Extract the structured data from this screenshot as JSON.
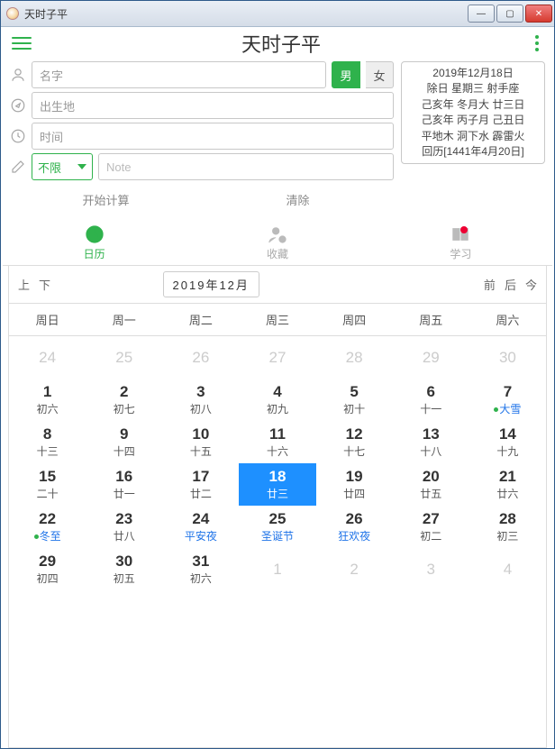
{
  "window": {
    "title": "天时子平"
  },
  "appbar": {
    "title": "天时子平"
  },
  "form": {
    "name_placeholder": "名字",
    "birthplace_placeholder": "出生地",
    "time_placeholder": "时间",
    "gender_male": "男",
    "gender_female": "女",
    "limit_label": "不限",
    "note_placeholder": "Note"
  },
  "info": {
    "l1": "2019年12月18日",
    "l2": "除日 星期三 射手座",
    "l3": "己亥年 冬月大 廿三日",
    "l4": "己亥年 丙子月 己丑日",
    "l5": "平地木 洞下水 霹雷火",
    "l6": "回历[1441年4月20日]"
  },
  "actions": {
    "start": "开始计算",
    "clear": "清除"
  },
  "tabs": {
    "calendar": "日历",
    "favorites": "收藏",
    "study": "学习"
  },
  "calnav": {
    "prev_page": "上",
    "next_page": "下",
    "month_label": "2019年12月",
    "prev": "前",
    "next": "后",
    "today": "今"
  },
  "weekdays": [
    "周日",
    "周一",
    "周二",
    "周三",
    "周四",
    "周五",
    "周六"
  ],
  "cells": [
    {
      "d": "24",
      "s": "",
      "cls": "dim"
    },
    {
      "d": "25",
      "s": "",
      "cls": "dim"
    },
    {
      "d": "26",
      "s": "",
      "cls": "dim"
    },
    {
      "d": "27",
      "s": "",
      "cls": "dim"
    },
    {
      "d": "28",
      "s": "",
      "cls": "dim"
    },
    {
      "d": "29",
      "s": "",
      "cls": "dim"
    },
    {
      "d": "30",
      "s": "",
      "cls": "dim"
    },
    {
      "d": "1",
      "s": "初六"
    },
    {
      "d": "2",
      "s": "初七"
    },
    {
      "d": "3",
      "s": "初八"
    },
    {
      "d": "4",
      "s": "初九"
    },
    {
      "d": "5",
      "s": "初十"
    },
    {
      "d": "6",
      "s": "十一"
    },
    {
      "d": "7",
      "s": "大雪",
      "scls": "term"
    },
    {
      "d": "8",
      "s": "十三"
    },
    {
      "d": "9",
      "s": "十四"
    },
    {
      "d": "10",
      "s": "十五"
    },
    {
      "d": "11",
      "s": "十六"
    },
    {
      "d": "12",
      "s": "十七"
    },
    {
      "d": "13",
      "s": "十八"
    },
    {
      "d": "14",
      "s": "十九"
    },
    {
      "d": "15",
      "s": "二十"
    },
    {
      "d": "16",
      "s": "廿一"
    },
    {
      "d": "17",
      "s": "廿二"
    },
    {
      "d": "18",
      "s": "廿三",
      "cls": "today"
    },
    {
      "d": "19",
      "s": "廿四"
    },
    {
      "d": "20",
      "s": "廿五"
    },
    {
      "d": "21",
      "s": "廿六"
    },
    {
      "d": "22",
      "s": "冬至",
      "scls": "term"
    },
    {
      "d": "23",
      "s": "廿八"
    },
    {
      "d": "24",
      "s": "平安夜",
      "scls": "blue"
    },
    {
      "d": "25",
      "s": "圣诞节",
      "scls": "blue"
    },
    {
      "d": "26",
      "s": "狂欢夜",
      "scls": "blue"
    },
    {
      "d": "27",
      "s": "初二"
    },
    {
      "d": "28",
      "s": "初三"
    },
    {
      "d": "29",
      "s": "初四"
    },
    {
      "d": "30",
      "s": "初五"
    },
    {
      "d": "31",
      "s": "初六"
    },
    {
      "d": "1",
      "s": "",
      "cls": "dim"
    },
    {
      "d": "2",
      "s": "",
      "cls": "dim"
    },
    {
      "d": "3",
      "s": "",
      "cls": "dim"
    },
    {
      "d": "4",
      "s": "",
      "cls": "dim"
    }
  ]
}
